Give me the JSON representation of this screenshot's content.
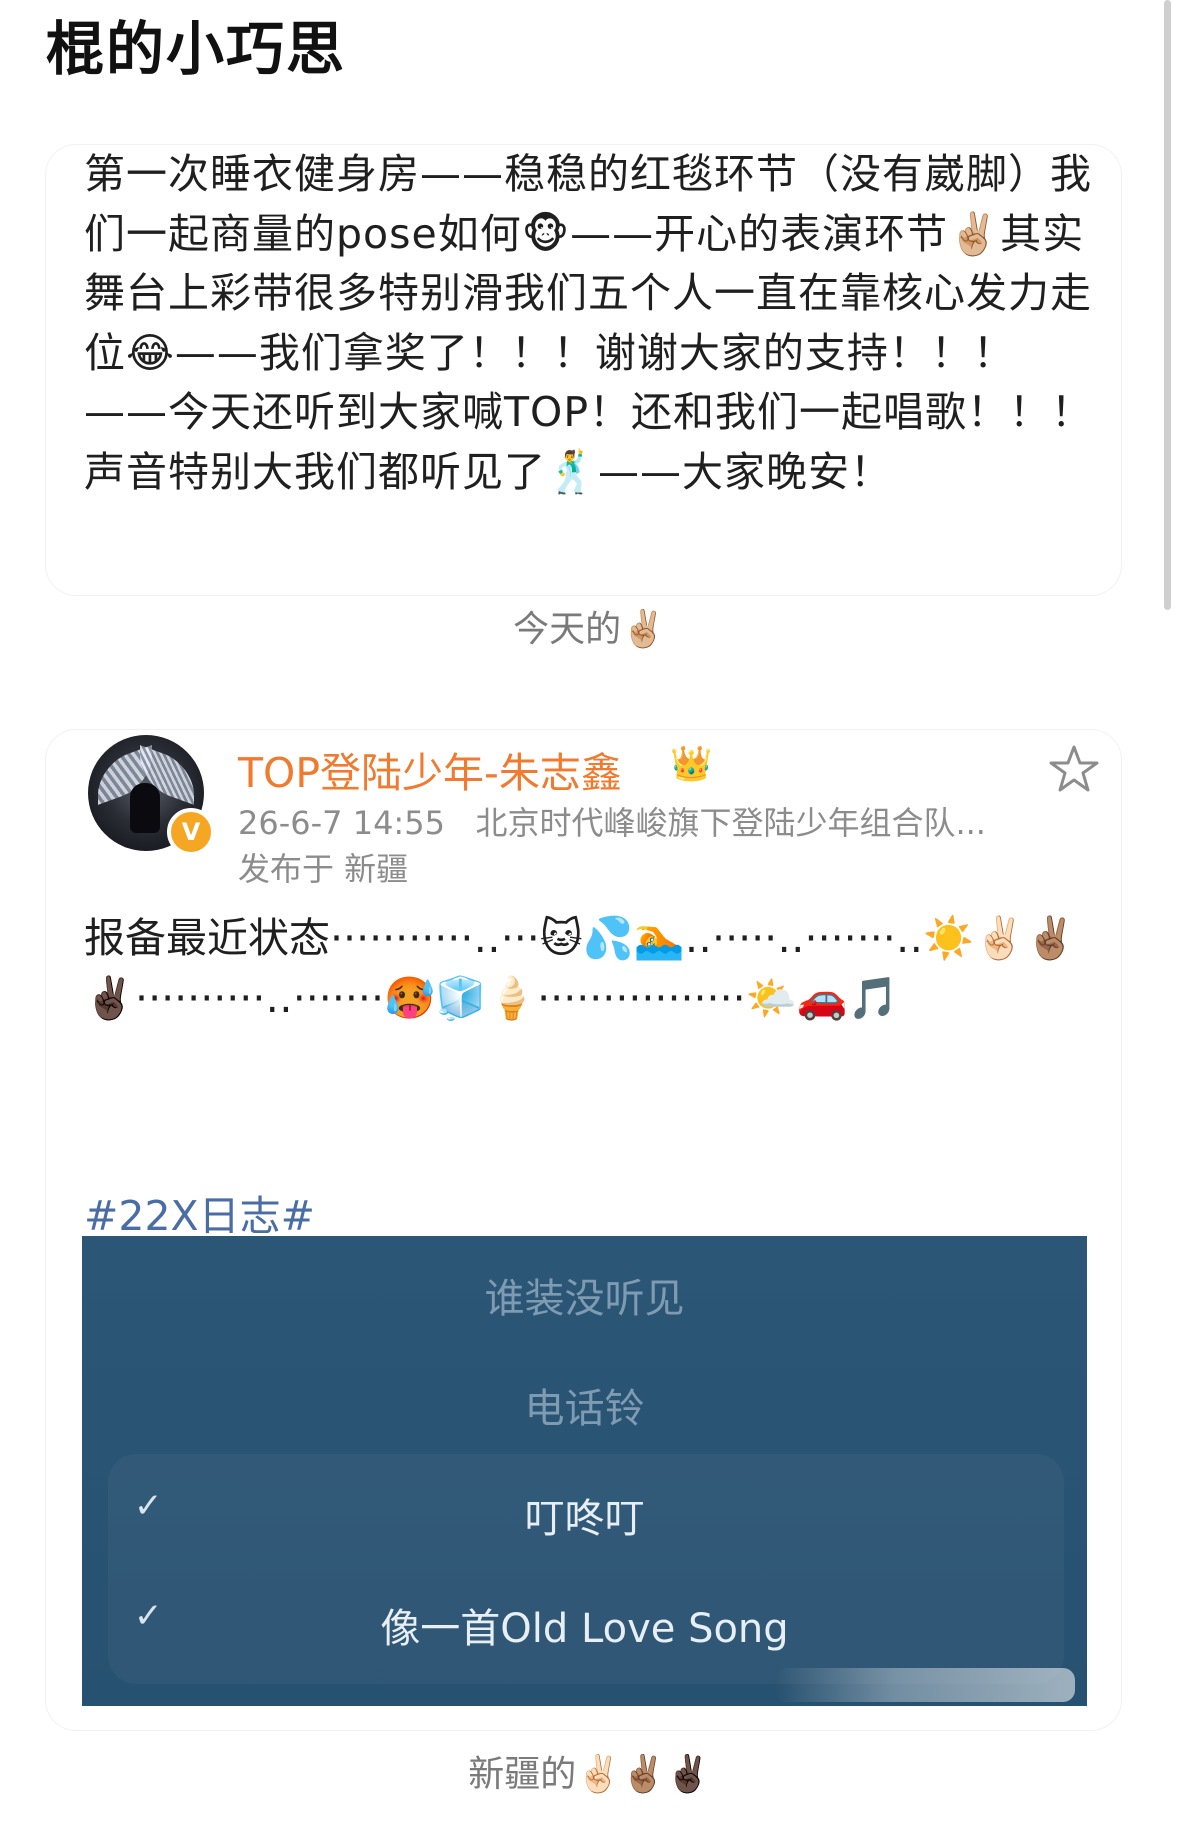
{
  "header": {
    "title": "棍的小巧思"
  },
  "card1": {
    "text": "第一次睡衣健身房——稳稳的红毯环节（没有崴脚）我们一起商量的pose如何🐵——开心的表演环节✌🏼其实舞台上彩带很多特别滑我们五个人一直在靠核心发力走位😂——我们拿奖了！！！谢谢大家的支持！！！——今天还听到大家喊TOP！还和我们一起唱歌！！！声音特别大我们都听见了🕺——大家晚安！"
  },
  "caption1": "今天的✌🏼",
  "post": {
    "username": "TOP登陆少年-朱志鑫",
    "badge_icon": "crown-badge-icon",
    "verified_mark": "V",
    "date": "26-6-7 14:55",
    "source": "北京时代峰峻旗下登陆少年组合队...",
    "location": "发布于 新疆",
    "text": "报备最近状态···········‥···🐱💦🏊‥·····‥·······‥☀️✌🏻✌🏽✌🏿··········‥·······🥵🧊🍦················🌤️🚗🎵",
    "topic": "#22X日志#"
  },
  "music_panel": {
    "items": [
      {
        "label": "谁装没听见",
        "checked": false
      },
      {
        "label": "电话铃",
        "checked": false
      },
      {
        "label": "叮咚叮",
        "checked": true
      },
      {
        "label": "像一首Old Love Song",
        "checked": true
      }
    ],
    "check_mark": "✓"
  },
  "caption2": "新疆的✌🏻✌🏽✌🏿",
  "colors": {
    "username": "#f07a2e",
    "topic": "#4a6da6",
    "panel": "#2c5676"
  }
}
